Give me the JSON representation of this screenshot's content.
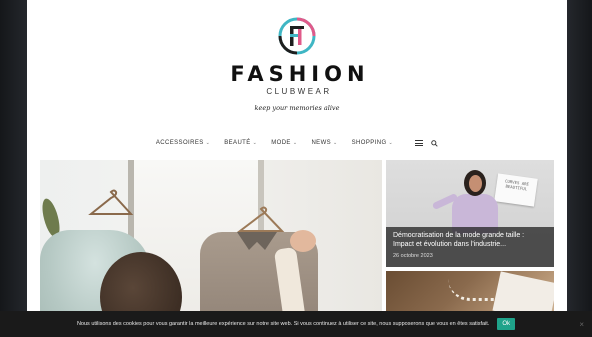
{
  "brand": {
    "title": "FASHION",
    "subtitle": "CLUBWEAR",
    "tagline": "keep your memories alive"
  },
  "nav": {
    "items": [
      {
        "label": "ACCESSOIRES"
      },
      {
        "label": "BEAUTÉ"
      },
      {
        "label": "MODE"
      },
      {
        "label": "NEWS"
      },
      {
        "label": "SHOPPING"
      }
    ]
  },
  "cards": [
    {
      "title": "Démocratisation de la mode grande taille : Impact et évolution dans l'industrie...",
      "date": "26 octobre 2023",
      "sign_text": "CURVES ARE BEAUTIFUL"
    }
  ],
  "cookie": {
    "text": "Nous utilisons des cookies pour vous garantir la meilleure expérience sur notre site web. Si vous continuez à utiliser ce site, nous supposerons que vous en êtes satisfait.",
    "ok_label": "Ok",
    "close_symbol": "×"
  },
  "colors": {
    "accent": "#1fa38a",
    "logo_teal": "#3fb6c4",
    "logo_pink": "#e05a8a",
    "logo_dark": "#1e1e1e"
  }
}
